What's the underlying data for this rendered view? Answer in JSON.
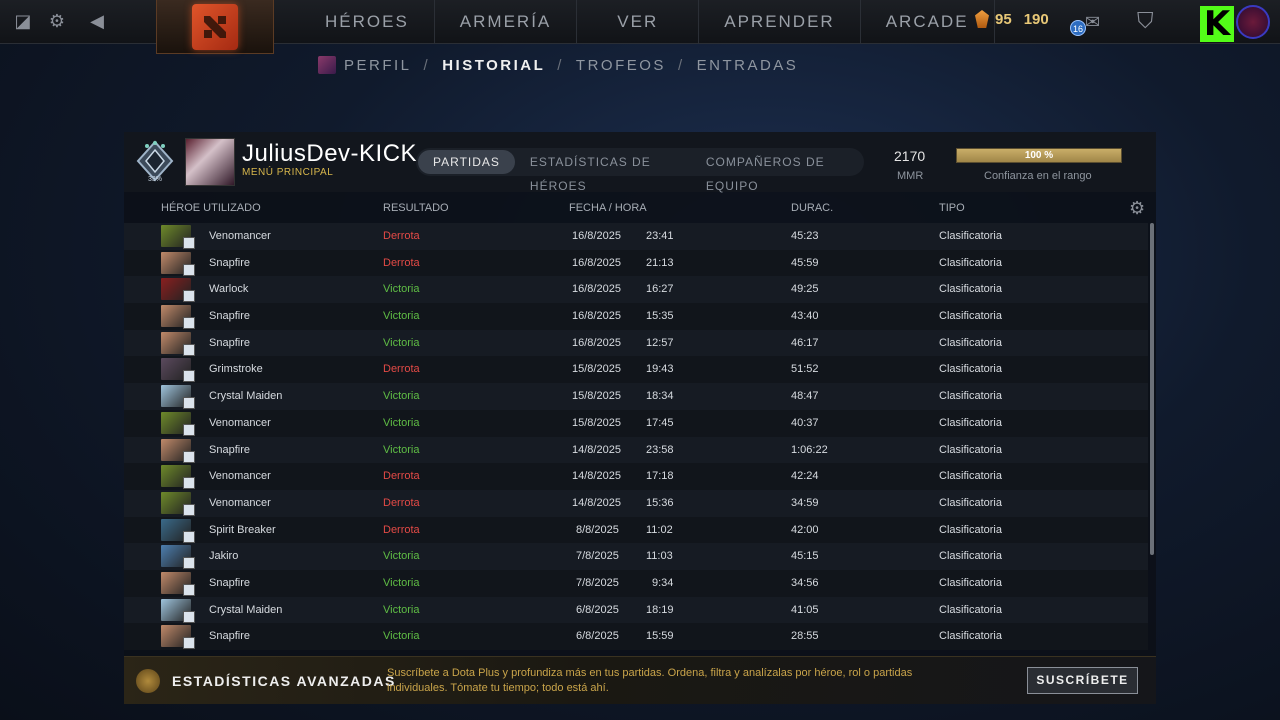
{
  "topbar": {
    "nav": [
      "HÉROES",
      "ARMERÍA",
      "VER",
      "APRENDER",
      "ARCADE"
    ],
    "currency": {
      "shards": "95",
      "gold": "190"
    },
    "notification_count": "16",
    "streamer_logo": "K"
  },
  "subnav": {
    "items": [
      "PERFIL",
      "HISTORIAL",
      "TROFEOS",
      "ENTRADAS"
    ],
    "active": "HISTORIAL"
  },
  "profile": {
    "name": "JuliusDev-KICK",
    "subtitle": "MENÚ PRINCIPAL",
    "rank_percent": "33%",
    "mmr_value": "2170",
    "mmr_label": "MMR",
    "confidence_percent": 100,
    "confidence_text": "100 %",
    "confidence_label": "Confianza en el rango"
  },
  "tabs": [
    "PARTIDAS",
    "ESTADÍSTICAS DE HÉROES",
    "COMPAÑEROS DE EQUIPO"
  ],
  "table": {
    "headers": {
      "hero": "HÉROE UTILIZADO",
      "result": "RESULTADO",
      "date": "FECHA / HORA",
      "duration": "DURAC.",
      "type": "TIPO"
    },
    "rows": [
      {
        "hero": "Venomancer",
        "result": "Derrota",
        "date": "16/8/2025",
        "time": "23:41",
        "duration": "45:23",
        "type": "Clasificatoria"
      },
      {
        "hero": "Snapfire",
        "result": "Derrota",
        "date": "16/8/2025",
        "time": "21:13",
        "duration": "45:59",
        "type": "Clasificatoria"
      },
      {
        "hero": "Warlock",
        "result": "Victoria",
        "date": "16/8/2025",
        "time": "16:27",
        "duration": "49:25",
        "type": "Clasificatoria"
      },
      {
        "hero": "Snapfire",
        "result": "Victoria",
        "date": "16/8/2025",
        "time": "15:35",
        "duration": "43:40",
        "type": "Clasificatoria"
      },
      {
        "hero": "Snapfire",
        "result": "Victoria",
        "date": "16/8/2025",
        "time": "12:57",
        "duration": "46:17",
        "type": "Clasificatoria"
      },
      {
        "hero": "Grimstroke",
        "result": "Derrota",
        "date": "15/8/2025",
        "time": "19:43",
        "duration": "51:52",
        "type": "Clasificatoria"
      },
      {
        "hero": "Crystal Maiden",
        "result": "Victoria",
        "date": "15/8/2025",
        "time": "18:34",
        "duration": "48:47",
        "type": "Clasificatoria"
      },
      {
        "hero": "Venomancer",
        "result": "Victoria",
        "date": "15/8/2025",
        "time": "17:45",
        "duration": "40:37",
        "type": "Clasificatoria"
      },
      {
        "hero": "Snapfire",
        "result": "Victoria",
        "date": "14/8/2025",
        "time": "23:58",
        "duration": "1:06:22",
        "type": "Clasificatoria"
      },
      {
        "hero": "Venomancer",
        "result": "Derrota",
        "date": "14/8/2025",
        "time": "17:18",
        "duration": "42:24",
        "type": "Clasificatoria"
      },
      {
        "hero": "Venomancer",
        "result": "Derrota",
        "date": "14/8/2025",
        "time": "15:36",
        "duration": "34:59",
        "type": "Clasificatoria"
      },
      {
        "hero": "Spirit Breaker",
        "result": "Derrota",
        "date": "8/8/2025",
        "time": "11:02",
        "duration": "42:00",
        "type": "Clasificatoria"
      },
      {
        "hero": "Jakiro",
        "result": "Victoria",
        "date": "7/8/2025",
        "time": "11:03",
        "duration": "45:15",
        "type": "Clasificatoria"
      },
      {
        "hero": "Snapfire",
        "result": "Victoria",
        "date": "7/8/2025",
        "time": "9:34",
        "duration": "34:56",
        "type": "Clasificatoria"
      },
      {
        "hero": "Crystal Maiden",
        "result": "Victoria",
        "date": "6/8/2025",
        "time": "18:19",
        "duration": "41:05",
        "type": "Clasificatoria"
      },
      {
        "hero": "Snapfire",
        "result": "Victoria",
        "date": "6/8/2025",
        "time": "15:59",
        "duration": "28:55",
        "type": "Clasificatoria"
      }
    ]
  },
  "hero_colors": {
    "Venomancer": "#6e8a2a",
    "Snapfire": "#c08a6a",
    "Warlock": "#8a1f1f",
    "Grimstroke": "#5b4a5e",
    "Crystal Maiden": "#9fc4dd",
    "Spirit Breaker": "#3a6a8a",
    "Jakiro": "#4d7fb0"
  },
  "colors": {
    "loss": "#e34a46",
    "win": "#5fbd45",
    "accent_gold": "#d7b64c"
  },
  "promo": {
    "title": "ESTADÍSTICAS AVANZADAS",
    "text": "Suscríbete a Dota Plus y profundiza más en tus partidas. Ordena, filtra y analízalas por héroe, rol o partidas individuales. Tómate tu tiempo; todo está ahí.",
    "button": "SUSCRÍBETE"
  },
  "icons": [
    "dota-logo-icon",
    "gear-icon",
    "back-arrow-icon",
    "mail-icon",
    "armory-icon",
    "settings-icon",
    "rank-medal-icon"
  ]
}
